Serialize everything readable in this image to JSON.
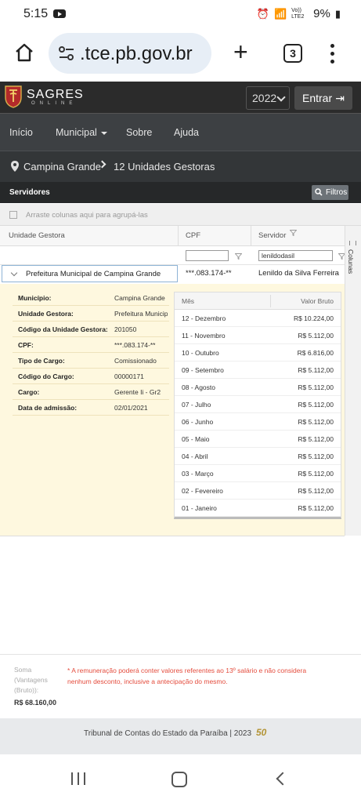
{
  "status_bar": {
    "time": "5:15",
    "battery": "9%",
    "network": "Vo)) LTE2"
  },
  "browser": {
    "url": ".tce.pb.gov.br",
    "tab_count": "3"
  },
  "header": {
    "brand": "SAGRES",
    "brand_sub": "ONLINE",
    "year": "2022",
    "login_label": "Entrar"
  },
  "nav": {
    "items": [
      "Início",
      "Municipal",
      "Sobre",
      "Ajuda"
    ]
  },
  "breadcrumb": {
    "city": "Campina Grande",
    "units": "12 Unidades Gestoras"
  },
  "panel": {
    "title": "Servidores",
    "filter_button": "Filtros",
    "group_hint": "Arraste colunas aqui para agrupá-las",
    "columns_tab": "Colunas"
  },
  "grid": {
    "headers": {
      "unit": "Unidade Gestora",
      "cpf": "CPF",
      "server": "Servidor"
    },
    "filters": {
      "cpf": "",
      "server": "lenildodasil"
    },
    "group_row": {
      "unit": "Prefeitura Municipal de Campina Grande",
      "cpf": "***.083.174-**",
      "server": "Lenildo da Silva Ferreira"
    }
  },
  "details": [
    {
      "label": "Município:",
      "value": "Campina Grande"
    },
    {
      "label": "Unidade Gestora:",
      "value": "Prefeitura Municipal de Campina Grande"
    },
    {
      "label": "Código da Unidade Gestora:",
      "value": "201050"
    },
    {
      "label": "CPF:",
      "value": "***.083.174-**"
    },
    {
      "label": "Tipo de Cargo:",
      "value": "Comissionado"
    },
    {
      "label": "Código do Cargo:",
      "value": "00000171"
    },
    {
      "label": "Cargo:",
      "value": "Gerente Ii - Gr2"
    },
    {
      "label": "Data de admissão:",
      "value": "02/01/2021"
    }
  ],
  "payments": {
    "headers": {
      "month": "Mês",
      "value": "Valor Bruto"
    },
    "rows": [
      {
        "month": "12 - Dezembro",
        "value": "R$ 10.224,00"
      },
      {
        "month": "11 - Novembro",
        "value": "R$ 5.112,00"
      },
      {
        "month": "10 - Outubro",
        "value": "R$ 6.816,00"
      },
      {
        "month": "09 - Setembro",
        "value": "R$ 5.112,00"
      },
      {
        "month": "08 - Agosto",
        "value": "R$ 5.112,00"
      },
      {
        "month": "07 - Julho",
        "value": "R$ 5.112,00"
      },
      {
        "month": "06 - Junho",
        "value": "R$ 5.112,00"
      },
      {
        "month": "05 - Maio",
        "value": "R$ 5.112,00"
      },
      {
        "month": "04 - Abril",
        "value": "R$ 5.112,00"
      },
      {
        "month": "03 - Março",
        "value": "R$ 5.112,00"
      },
      {
        "month": "02 - Fevereiro",
        "value": "R$ 5.112,00"
      },
      {
        "month": "01 - Janeiro",
        "value": "R$ 5.112,00"
      }
    ]
  },
  "summary": {
    "label": "Soma (Vantagens (Bruto)):",
    "total": "R$ 68.160,00",
    "note": "* A remuneração poderá conter valores referentes ao 13º salário e não considera nenhum desconto, inclusive a antecipação do mesmo."
  },
  "footer": {
    "text": "Tribunal de Contas do Estado da Paraíba | 2023",
    "logo_text": "50"
  },
  "colors": {
    "header_bg": "#2b2b2b",
    "nav_bg": "#3d4043",
    "detail_bg": "#fef8df",
    "note_red": "#e44c3d"
  }
}
